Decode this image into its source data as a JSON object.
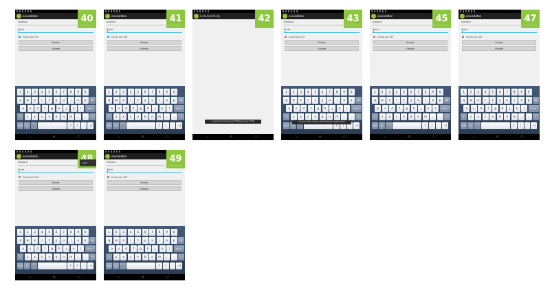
{
  "keyboard": {
    "row1": [
      "1",
      "2",
      "3",
      "4",
      "5",
      "6",
      "7",
      "8",
      "9",
      "0"
    ],
    "row2": [
      "q",
      "w",
      "e",
      "r",
      "t",
      "y",
      "u",
      "i",
      "o",
      "p"
    ],
    "row3": [
      "a",
      "s",
      "d",
      "f",
      "g",
      "h",
      "j",
      "k",
      "l"
    ],
    "row4": [
      "z",
      "x",
      "c",
      "v",
      "b",
      "n",
      "m",
      ",",
      "."
    ],
    "row5": [
      "?",
      "!",
      "'",
      ":-)"
    ],
    "backspace_icon": "backspace-icon",
    "shift_icon": "shift-icon",
    "mic_icon": "mic-icon",
    "settings_icon": "settings-icon"
  },
  "colors": {
    "badge": "#8dc63f",
    "accent": "#33b5e5",
    "keyboard_bg": "#2b3d55"
  },
  "screens": [
    {
      "badge": "40",
      "title": "enviodatos",
      "form": true,
      "nombre_label": "Nombre",
      "texto_label": "Texto",
      "checkbox_label": "Enviar por GET",
      "checked": true,
      "enviar_label": "Enviar",
      "listado_label": "Listado",
      "action_key": "Next",
      "keyboard": true
    },
    {
      "badge": "41",
      "title": "enviodatos",
      "form": true,
      "nombre_label": "Nombre",
      "texto_label": "Texto",
      "checkbox_label": "Enviar por GET",
      "checked": true,
      "enviar_label": "Enviar",
      "listado_label": "Listado",
      "action_key": "Next",
      "keyboard": true
    },
    {
      "badge": "42",
      "title": "ListadoActivity",
      "form": false,
      "toast": "org.appsfor.fbl.mensaje.fbextFlbl/Apperces/2775686",
      "keyboard": false
    },
    {
      "badge": "43",
      "title": "enviodatos",
      "form": true,
      "nombre_label": "Nombre",
      "texto_label": "Texto",
      "checkbox_label": "Enviar por GET",
      "checked": false,
      "enviar_label": "Enviar",
      "listado_label": "Listado",
      "action_key": "Done",
      "keyboard": true,
      "toast": "org.apache.http.message.BasicHttpResponse@27c3b00e"
    },
    {
      "badge": "45",
      "title": "enviodatos",
      "form": true,
      "nombre_label": "Nombre",
      "texto_label": "Texto",
      "checkbox_label": "Enviar por GET",
      "checked": false,
      "enviar_label": "Enviar",
      "listado_label": "Listado",
      "action_key": "Done",
      "keyboard": true
    },
    {
      "badge": "47",
      "title": "enviodatos",
      "form": true,
      "nombre_label": "Nombre",
      "texto_label": "Texto",
      "checkbox_label": "Enviar por GET",
      "checked": false,
      "enviar_label": "Enviar",
      "listado_label": "Listado",
      "action_key": "Done",
      "keyboard": true
    },
    {
      "badge": "48",
      "title": "enviodatos",
      "form": true,
      "nombre_label": "Nombre",
      "texto_label": "Texto",
      "checkbox_label": "Enviar por GET",
      "checked": false,
      "enviar_label": "Enviar",
      "listado_label": "Listado",
      "action_key": "Done",
      "keyboard": true,
      "menu_item": "Setti"
    },
    {
      "badge": "49",
      "title": "enviodatos",
      "form": true,
      "nombre_label": "Nombre",
      "texto_label": "Texto",
      "checkbox_label": "Enviar por GET",
      "checked": false,
      "enviar_label": "Enviar",
      "listado_label": "Listado",
      "action_key": "Done",
      "keyboard": true
    }
  ]
}
